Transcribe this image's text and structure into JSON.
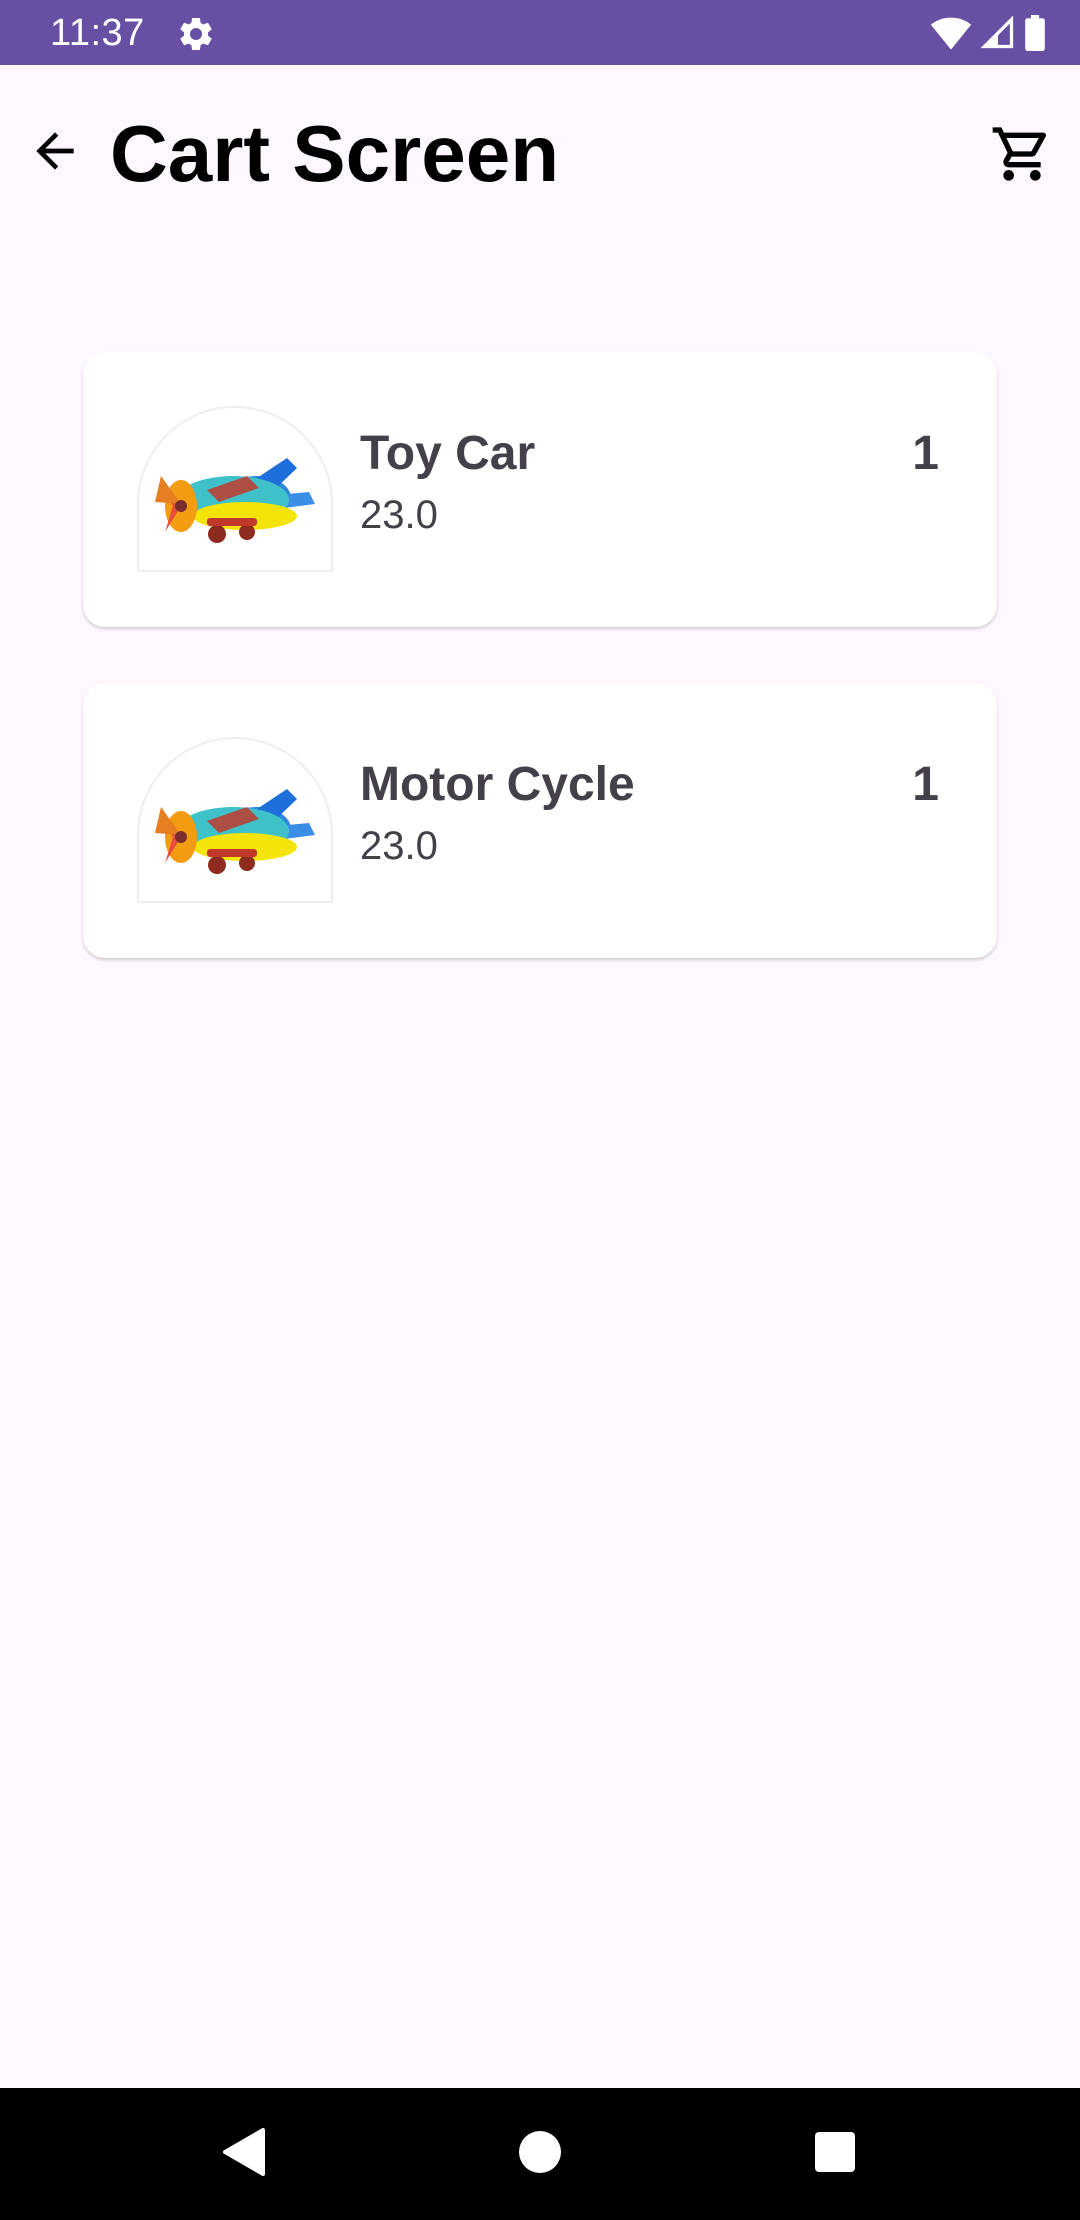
{
  "status_bar": {
    "time": "11:37",
    "icons": [
      "settings-gear-icon",
      "wifi-icon",
      "cell-signal-icon",
      "battery-icon"
    ],
    "color": "#6750A4"
  },
  "app_bar": {
    "title": "Cart Screen",
    "back_icon": "arrow-back-icon",
    "cart_icon": "shopping-cart-icon"
  },
  "cart": {
    "items": [
      {
        "name": "Toy Car",
        "price": "23.0",
        "quantity": "1",
        "image": "toy-airplane-image"
      },
      {
        "name": "Motor Cycle",
        "price": "23.0",
        "quantity": "1",
        "image": "toy-airplane-image"
      }
    ]
  },
  "nav_bar": {
    "buttons": [
      "back-triangle-icon",
      "home-circle-icon",
      "recents-square-icon"
    ]
  },
  "colors": {
    "background": "#FDF7FF",
    "card": "#FFFFFF",
    "text_secondary": "#43404A",
    "accent": "#6750A4"
  }
}
